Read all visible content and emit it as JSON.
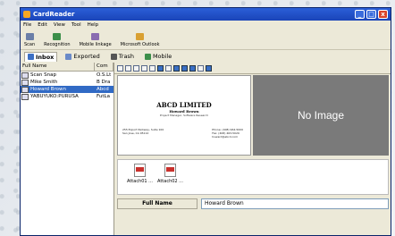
{
  "window": {
    "title": "CardReader"
  },
  "menu": [
    "File",
    "Edit",
    "View",
    "Tool",
    "Help"
  ],
  "toolbar": [
    {
      "label": "Scan",
      "icon": "scanner-icon",
      "color": "#6b7fa8"
    },
    {
      "label": "Recognition",
      "icon": "recognize-icon",
      "color": "#3c8f4a"
    },
    {
      "label": "Mobile linkage",
      "icon": "phone-icon",
      "color": "#8a6cb0"
    },
    {
      "label": "Microsoft Outlook",
      "icon": "outlook-icon",
      "color": "#d9a032"
    }
  ],
  "tabs": [
    {
      "label": "Inbox",
      "icon": "inbox-icon",
      "color": "#3c6fc4",
      "active": true
    },
    {
      "label": "Exported",
      "icon": "export-icon",
      "color": "#6a8ac8",
      "active": false
    },
    {
      "label": "Trash",
      "icon": "trash-icon",
      "color": "#555555",
      "active": false
    },
    {
      "label": "Mobile",
      "icon": "mobile-icon",
      "color": "#3c8f4a",
      "active": false
    }
  ],
  "list": {
    "headers": [
      "Full Name",
      "Com"
    ],
    "rows": [
      {
        "name": "Scan Snap",
        "company": "O.S.Lt"
      },
      {
        "name": "Mike Smith",
        "company": "B Dra"
      },
      {
        "name": "Howard Brown",
        "company": "Abcd",
        "selected": true
      },
      {
        "name": "YABUYUKO:PURUSA",
        "company": "FutLa"
      }
    ]
  },
  "card": {
    "company": "ABCD LIMITED",
    "name": "Howard Brown",
    "title": "Project Manager, Software Research",
    "address_line1": "255 Export Parkway, Suite 100",
    "address_line2": "San Jose, CA 95112",
    "phone": "Phone: (408) 964-5000",
    "fax": "Fax: (408) 463-5029",
    "email": "howard@abcd.com"
  },
  "no_image": "No Image",
  "attachments": [
    {
      "label": "Attach01 ..."
    },
    {
      "label": "Attach02 ..."
    }
  ],
  "field": {
    "label": "Full Name",
    "value": "Howard Brown"
  }
}
